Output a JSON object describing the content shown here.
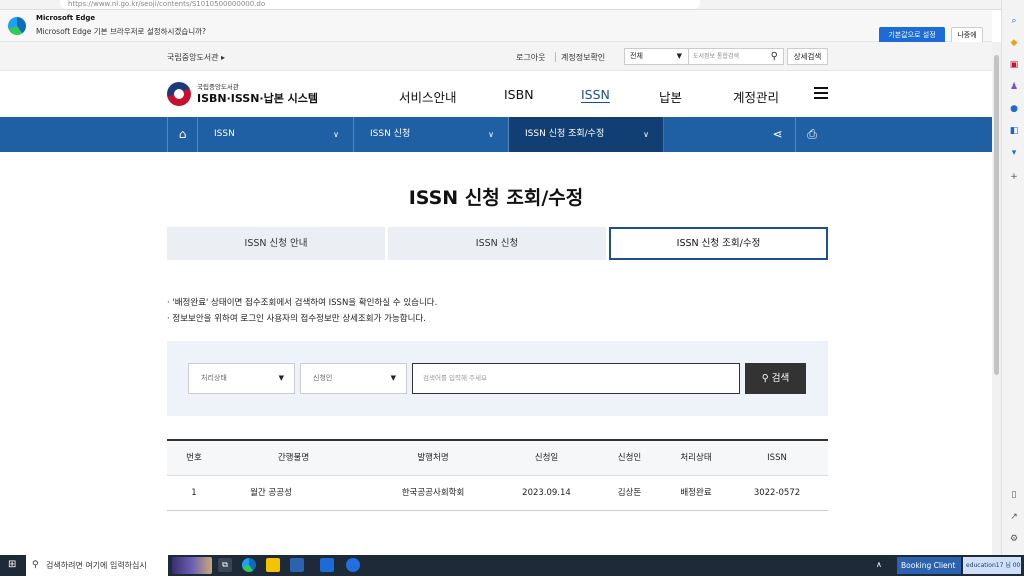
{
  "browser": {
    "url": "https://www.nl.go.kr/seoji/contents/S1010500000000.do",
    "notification_title": "Microsoft Edge",
    "notification_text": "Microsoft Edge 기본 브라우저로 설정하시겠습니까?",
    "set_default_label": "기본값으로 설정",
    "later_label": "나중에"
  },
  "utility": {
    "breadcrumb": "국립중앙도서관 ▸",
    "logout": "로그아웃",
    "account": "계정정보확인",
    "search_scope": "전체",
    "search_placeholder": "도서정보 통합검색",
    "detail_search": "상세검색"
  },
  "header": {
    "logo_sub": "국립중앙도서관",
    "logo_main": "ISBN·ISSN·납본 시스템",
    "menu": [
      "서비스안내",
      "ISBN",
      "ISSN",
      "납본",
      "계정관리"
    ],
    "active_menu": "ISSN"
  },
  "nav": {
    "seg1": "ISSN",
    "seg2": "ISSN 신청",
    "seg3": "ISSN 신청 조회/수정"
  },
  "page": {
    "title": "ISSN 신청 조회/수정",
    "tabs": [
      "ISSN 신청 안내",
      "ISSN 신청",
      "ISSN 신청 조회/수정"
    ],
    "active_tab": 2,
    "notes": [
      "· '배정완료' 상태이면 접수조회에서 검색하여 ISSN을 확인하실 수 있습니다.",
      "· 정보보안을 위하여 로그인 사용자의 접수정보만 상세조회가 가능합니다."
    ]
  },
  "search": {
    "status_select": "처리상태",
    "applicant_select": "신청인",
    "keyword_placeholder": "검색어를 입력해 주세요",
    "button": "검색"
  },
  "table": {
    "headers": [
      "번호",
      "간행물명",
      "발행처명",
      "신청일",
      "신청인",
      "처리상태",
      "ISSN"
    ],
    "rows": [
      [
        "1",
        "월간 공공성",
        "한국공공사회학회",
        "2023.09.14",
        "김상돈",
        "배정완료",
        "3022-0572"
      ]
    ]
  },
  "taskbar": {
    "search_text": "검색하려면 여기에 입력하십시",
    "app_label": "Booking Client",
    "tray_text": "education17 님 00분"
  }
}
